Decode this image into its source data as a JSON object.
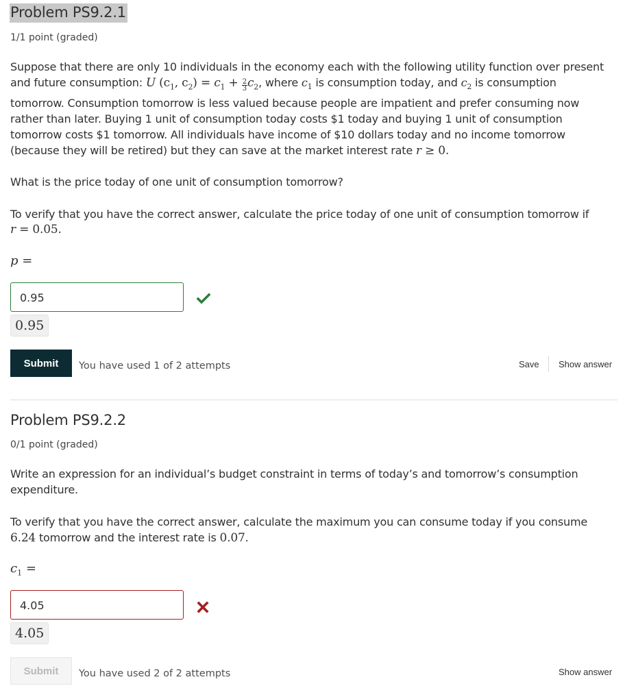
{
  "problems": [
    {
      "title": "Problem PS9.2.1",
      "points": "1/1 point (graded)",
      "intro": {
        "line1": "Suppose that there are only 10 individuals in the economy each with the following utility function over present",
        "line2_pre": "and future consumption: ",
        "utility_formula": {
          "U": "U",
          "lhs_args": "(c",
          "sub1": "1",
          "comma": ", c",
          "sub2": "2",
          "close": ")",
          "eq": " = ",
          "c1": "c",
          "c1sub": "1",
          "plus": " + ",
          "frac_num": "2",
          "frac_den": "3",
          "c2": "c",
          "c2sub": "2"
        },
        "line2_mid": ", where ",
        "c1_var": "c",
        "c1_sub": "1",
        "line2_mid2": " is consumption today, and ",
        "c2_var": "c",
        "c2_sub": "2",
        "line2_end": " is consumption",
        "line3": "tomorrow. Consumption tomorrow is less valued because people are impatient and prefer consuming now",
        "line4": "rather than later. Buying 1 unit of consumption today costs $1 today and buying 1 unit of consumption",
        "line5": "tomorrow costs $1 tomorrow. All individuals have income of $10 dollars today and no income tomorrow",
        "line6_pre": "(because they will be retired) but they can save at the market interest rate ",
        "line6_math_var": "r",
        "line6_math_rest": " ≥ 0."
      },
      "question": "What is the price today of one unit of consumption tomorrow?",
      "verify": {
        "line1": "To verify that you have the correct answer, calculate the price today of one unit of consumption tomorrow if",
        "math_var": "r",
        "math_rest": " = 0.05."
      },
      "answer_label_var": "p",
      "answer_label_rest": " =",
      "input_value": "0.95",
      "preview_value": "0.95",
      "status": "correct",
      "status_icon": "checkmark-icon",
      "status_color": "#2e7d3a",
      "submit_label": "Submit",
      "submit_enabled": true,
      "attempts_text": "You have used 1 of 2 attempts",
      "save_label": "Save",
      "show_answer_label": "Show answer"
    },
    {
      "title": "Problem PS9.2.2",
      "points": "0/1 point (graded)",
      "question_line1": "Write an expression for an individual’s budget constraint in terms of today’s and tomorrow’s consumption",
      "question_line2": "expenditure.",
      "verify": {
        "line1": "To verify that you have the correct answer, calculate the maximum you can consume today if you consume",
        "num1": "6.24",
        "mid": " tomorrow and the interest rate is ",
        "num2": "0.07",
        "end": "."
      },
      "answer_label_var": "c",
      "answer_label_sub": "1",
      "answer_label_rest": " =",
      "input_value": "4.05",
      "preview_value": "4.05",
      "status": "incorrect",
      "status_icon": "cross-icon",
      "status_color": "#a42020",
      "submit_label": "Submit",
      "submit_enabled": false,
      "attempts_text": "You have used 2 of 2 attempts",
      "show_answer_label": "Show answer"
    }
  ],
  "colors": {
    "submit_active_bg": "#0d2b33",
    "correct": "#2e7d3a",
    "incorrect": "#a42020",
    "title_highlight": "#c8c8c8"
  }
}
